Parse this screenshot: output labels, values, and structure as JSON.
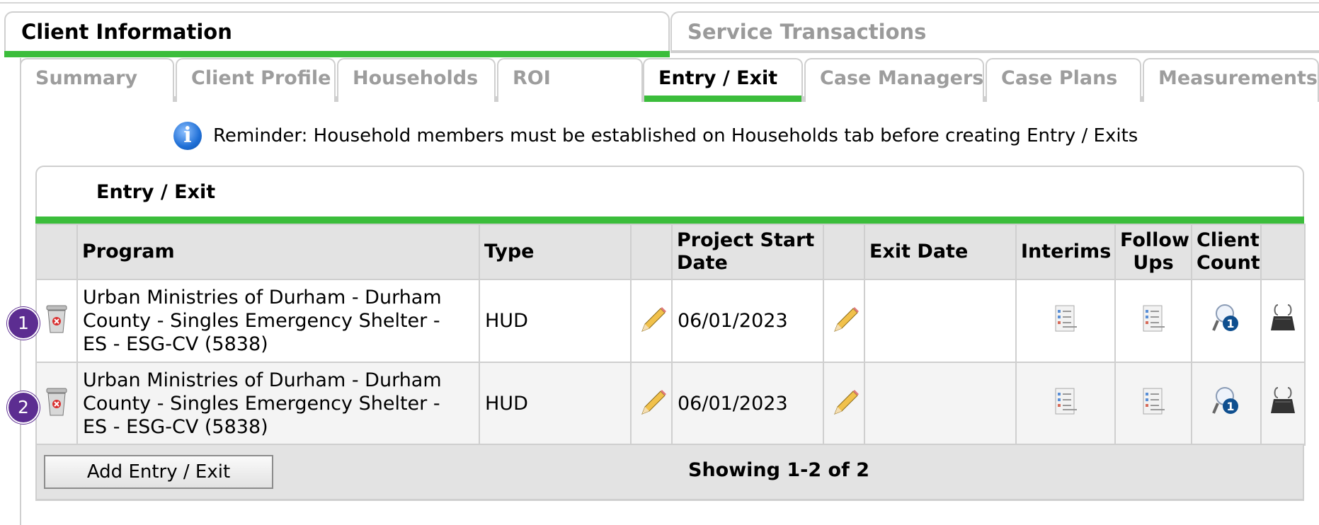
{
  "main_tabs": [
    {
      "label": "Client Information",
      "active": true
    },
    {
      "label": "Service Transactions",
      "active": false
    }
  ],
  "sub_tabs": [
    {
      "label": "Summary",
      "active": false
    },
    {
      "label": "Client Profile",
      "active": false
    },
    {
      "label": "Households",
      "active": false
    },
    {
      "label": "ROI",
      "active": false
    },
    {
      "label": "Entry / Exit",
      "active": true
    },
    {
      "label": "Case Managers",
      "active": false
    },
    {
      "label": "Case Plans",
      "active": false
    },
    {
      "label": "Measurements",
      "active": false
    }
  ],
  "reminder": {
    "icon": "info-icon",
    "text": "Reminder: Household members must be established on Households tab before creating Entry / Exits"
  },
  "panel": {
    "title": "Entry / Exit",
    "columns": {
      "program": "Program",
      "type": "Type",
      "start_line1": "Project Start",
      "start_line2": "Date",
      "exit_date": "Exit Date",
      "interims": "Interims",
      "followups_line1": "Follow",
      "followups_line2": "Ups",
      "count_line1": "Client",
      "count_line2": "Count"
    },
    "rows": [
      {
        "badge": "1",
        "program_line1": "Urban Ministries of Durham - Durham",
        "program_line2": "County - Singles Emergency Shelter -",
        "program_line3": "ES - ESG-CV (5838)",
        "type": "HUD",
        "start_date": "06/01/2023",
        "exit_date": ""
      },
      {
        "badge": "2",
        "program_line1": "Urban Ministries of Durham - Durham",
        "program_line2": "County - Singles Emergency Shelter -",
        "program_line3": "ES - ESG-CV (5838)",
        "type": "HUD",
        "start_date": "06/01/2023",
        "exit_date": ""
      }
    ],
    "add_button": "Add Entry / Exit",
    "showing": "Showing 1-2 of 2"
  },
  "colors": {
    "accent_green": "#3bbd3b",
    "badge_purple": "#5c2d91",
    "tab_border": "#cfcfcf"
  }
}
